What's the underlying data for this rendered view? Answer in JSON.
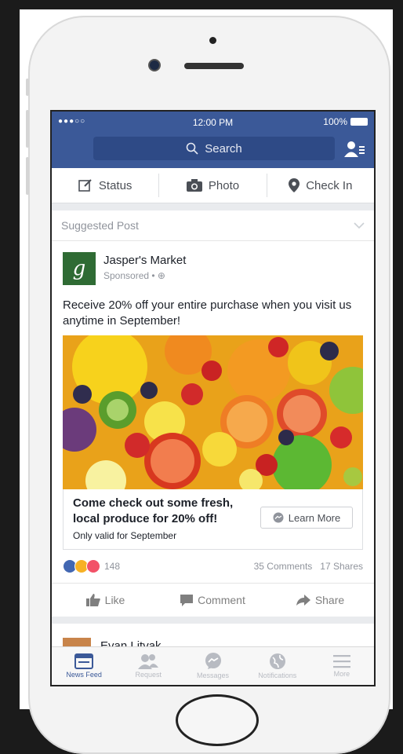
{
  "statusbar": {
    "signal": "●●●○○",
    "time": "12:00 PM",
    "battery": "100%"
  },
  "search": {
    "placeholder": "Search"
  },
  "composer": {
    "status": "Status",
    "photo": "Photo",
    "checkin": "Check In"
  },
  "post": {
    "suggested_label": "Suggested Post",
    "page_name": "Jasper's Market",
    "sponsored": "Sponsored • ⊕",
    "avatar_letter": "g",
    "text": "Receive 20% off your entire purchase when you visit us anytime in September!",
    "cta_headline": "Come check out some fresh, local produce for 20% off!",
    "cta_desc": "Only valid for September",
    "cta_button": "Learn More",
    "reaction_count": "148",
    "comments": "35 Comments",
    "shares": "17 Shares",
    "like": "Like",
    "comment": "Comment",
    "share": "Share"
  },
  "next_post": {
    "name": "Evan Litvak"
  },
  "tabs": [
    {
      "label": "News Feed",
      "icon": "news-feed-icon"
    },
    {
      "label": "Request",
      "icon": "friend-request-icon"
    },
    {
      "label": "Messages",
      "icon": "messages-icon"
    },
    {
      "label": "Notifications",
      "icon": "globe-icon"
    },
    {
      "label": "More",
      "icon": "menu-icon"
    }
  ],
  "colors": {
    "brand": "#3b5998",
    "background": "#e9ebee"
  }
}
